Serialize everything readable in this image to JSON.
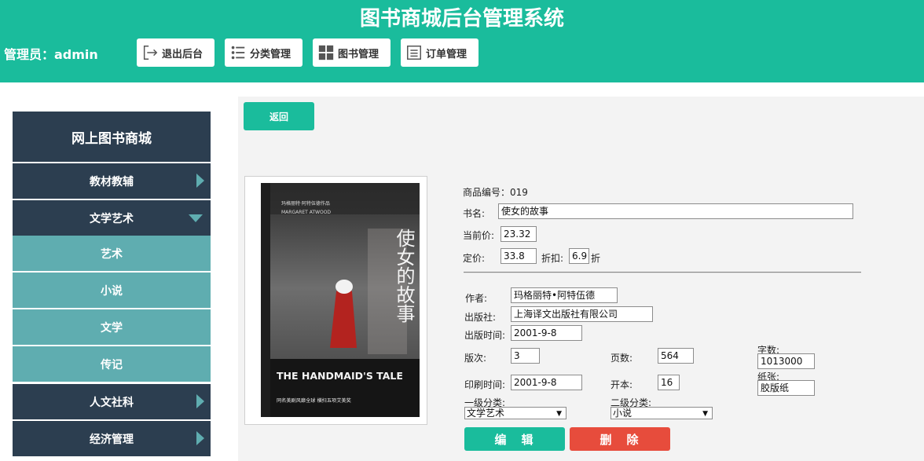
{
  "header": {
    "title": "图书商城后台管理系统",
    "admin": "管理员：admin",
    "buttons": {
      "logout": "退出后台",
      "category": "分类管理",
      "books": "图书管理",
      "orders": "订单管理"
    },
    "accent": "#1ABC9C"
  },
  "sidebar": {
    "title": "网上图书商城",
    "items": [
      {
        "label": "教材教辅"
      },
      {
        "label": "文学艺术"
      },
      {
        "label": "艺术"
      },
      {
        "label": "小说"
      },
      {
        "label": "文学"
      },
      {
        "label": "传记"
      },
      {
        "label": "人文社科"
      },
      {
        "label": "经济管理"
      }
    ]
  },
  "main": {
    "back_label": "返回",
    "cover": {
      "top_text": "玛格丽特·阿特伍德作品",
      "author_en": "MARGARET ATWOOD",
      "title_cn": "使女的故事",
      "title_en": "THE HANDMAID'S TALE",
      "tag": "同名美剧风靡全球  横扫五项艾美奖"
    },
    "labels": {
      "id": "商品编号：019",
      "name": "书名:",
      "current_price": "当前价:",
      "list_price": "定价:",
      "discount": "折扣:",
      "discount_unit": "折",
      "author": "作者:",
      "publisher": "出版社:",
      "pub_date": "出版时间:",
      "edition": "版次:",
      "pages": "页数:",
      "words": "字数:",
      "print_date": "印刷时间:",
      "format": "开本:",
      "paper": "纸张:",
      "cat1": "一级分类:",
      "cat2": "二级分类:"
    },
    "values": {
      "name": "使女的故事",
      "current_price": "23.32",
      "list_price": "33.8",
      "discount": "6.9",
      "author": "玛格丽特•阿特伍德",
      "publisher": "上海译文出版社有限公司",
      "pub_date": "2001-9-8",
      "edition": "3",
      "pages": "564",
      "words": "1013000",
      "print_date": "2001-9-8",
      "format": "16",
      "paper": "胶版纸",
      "cat1": "文学艺术",
      "cat2": "小说"
    },
    "edit_label": "编　辑",
    "delete_label": "删　除"
  }
}
